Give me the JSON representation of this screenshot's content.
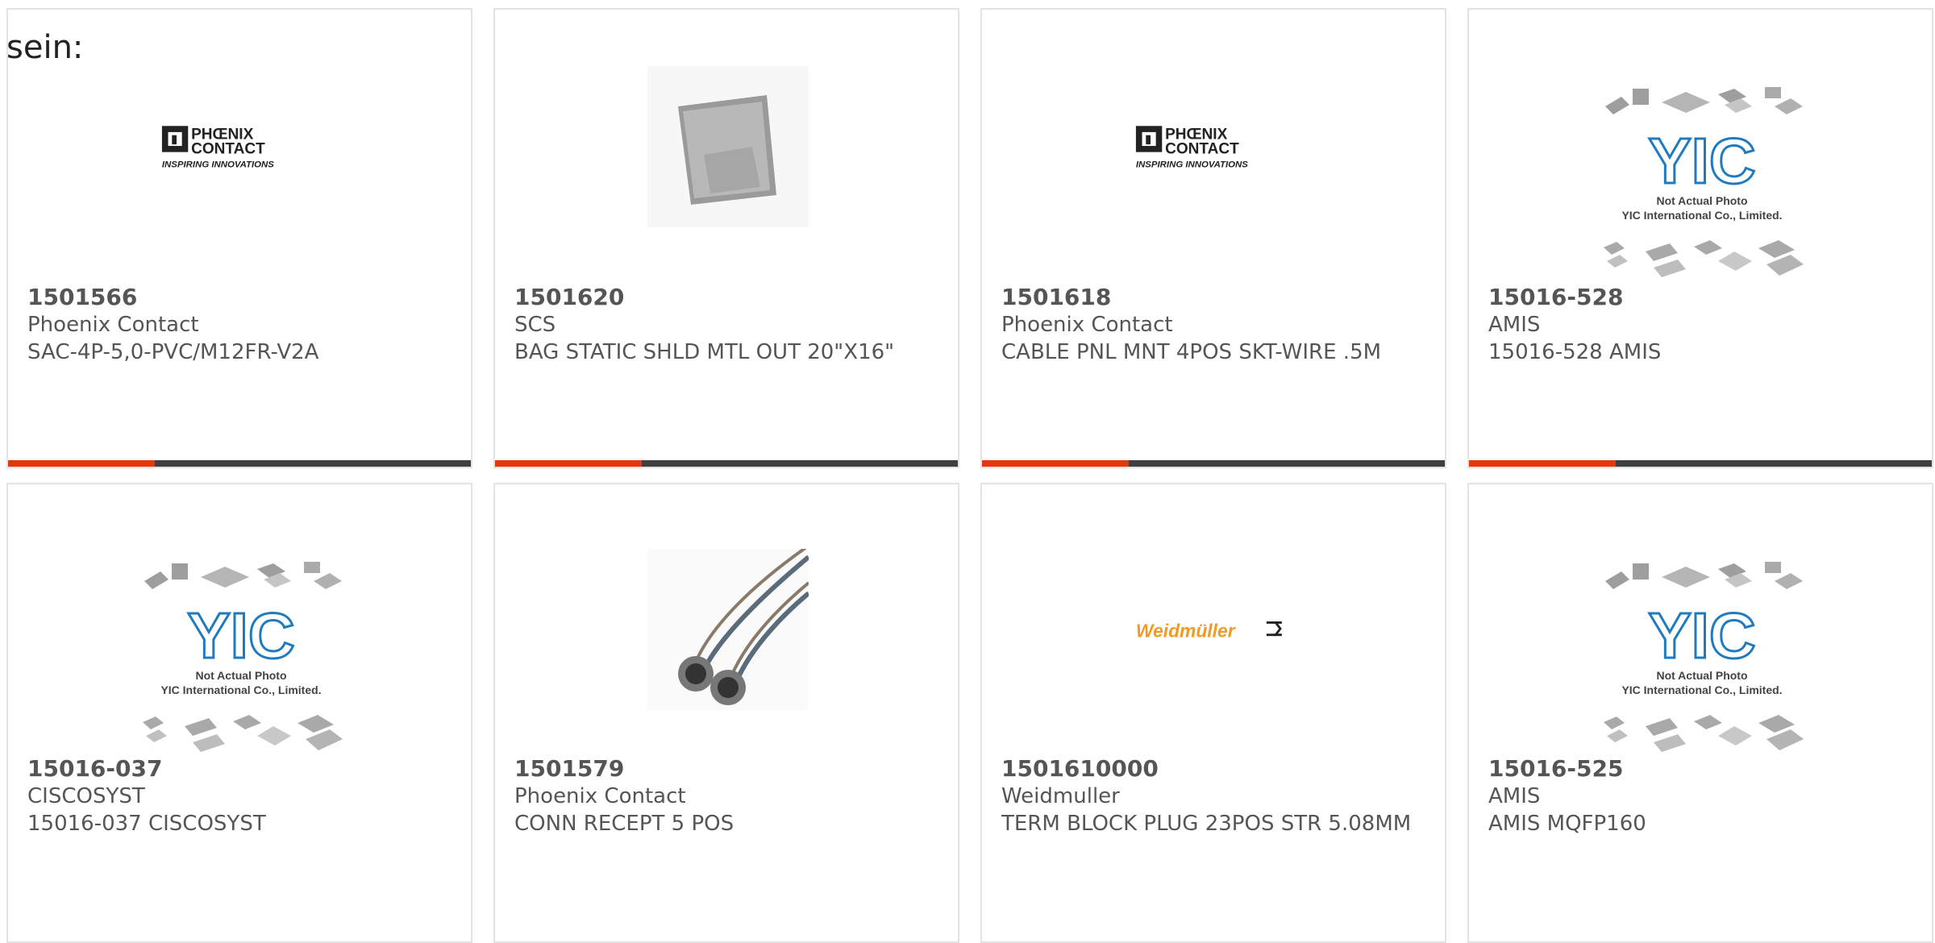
{
  "intro": "sein:",
  "colors": {
    "accent": "#e2380c",
    "bar": "#3f3f3f",
    "text": "#555555",
    "border": "#e3e3e3"
  },
  "logo": {
    "phoenix_line1": "PHŒNIX",
    "phoenix_line2": "CONTACT",
    "phoenix_tagline": "INSPIRING INNOVATIONS",
    "weidmuller": "Weidmüller",
    "yic_brand": "YIC",
    "yic_line1": "Not Actual Photo",
    "yic_line2": "YIC International Co., Limited."
  },
  "products": [
    {
      "part": "1501566",
      "mfr": "Phoenix Contact",
      "desc": "SAC-4P-5,0-PVC/M12FR-V2A",
      "image": "phoenix-logo"
    },
    {
      "part": "1501620",
      "mfr": "SCS",
      "desc": "BAG STATIC SHLD MTL OUT 20\"X16\"",
      "image": "static-bag-photo"
    },
    {
      "part": "1501618",
      "mfr": "Phoenix Contact",
      "desc": "CABLE PNL MNT 4POS SKT-WIRE .5M",
      "image": "phoenix-logo"
    },
    {
      "part": "15016-528",
      "mfr": "AMIS",
      "desc": "15016-528 AMIS",
      "image": "yic-placeholder"
    },
    {
      "part": "15016-037",
      "mfr": "CISCOSYST",
      "desc": "15016-037 CISCOSYST",
      "image": "yic-placeholder"
    },
    {
      "part": "1501579",
      "mfr": "Phoenix Contact",
      "desc": "CONN RECEPT 5 POS",
      "image": "connector-cable-photo"
    },
    {
      "part": "1501610000",
      "mfr": "Weidmuller",
      "desc": "TERM BLOCK PLUG 23POS STR 5.08MM",
      "image": "weidmuller-logo"
    },
    {
      "part": "15016-525",
      "mfr": "AMIS",
      "desc": "AMIS MQFP160",
      "image": "yic-placeholder"
    }
  ]
}
